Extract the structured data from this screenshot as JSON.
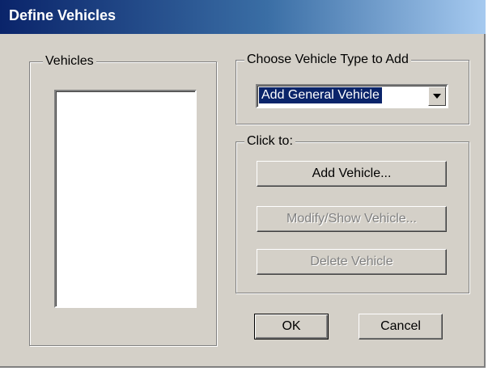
{
  "window": {
    "title": "Define Vehicles"
  },
  "vehicles_group": {
    "label": "Vehicles",
    "items": []
  },
  "vehicle_type_group": {
    "label": "Choose Vehicle Type to Add",
    "selected": "Add General Vehicle",
    "arrow_icon": "chevron-down-icon"
  },
  "click_group": {
    "label": "Click to:",
    "add_label": "Add Vehicle...",
    "modify_label": "Modify/Show Vehicle...",
    "delete_label": "Delete Vehicle"
  },
  "footer": {
    "ok_label": "OK",
    "cancel_label": "Cancel"
  },
  "colors": {
    "face": "#d4d0c8",
    "title_start": "#0a246a",
    "title_end": "#a6caf0",
    "selection": "#0a246a",
    "disabled_text": "#808080"
  }
}
